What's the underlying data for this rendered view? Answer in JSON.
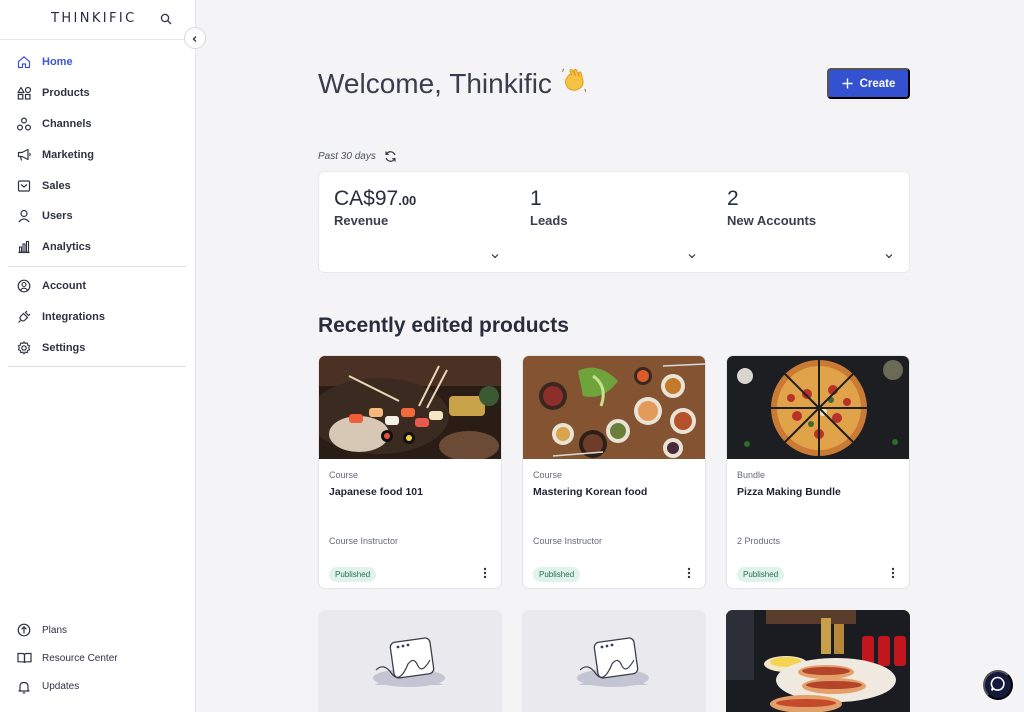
{
  "brand": {
    "name": "THINKIFIC"
  },
  "sidebar": {
    "items": [
      {
        "label": "Home",
        "icon": "home-icon",
        "active": true
      },
      {
        "label": "Products",
        "icon": "products-icon"
      },
      {
        "label": "Channels",
        "icon": "channels-icon"
      },
      {
        "label": "Marketing",
        "icon": "megaphone-icon"
      },
      {
        "label": "Sales",
        "icon": "sales-icon"
      },
      {
        "label": "Users",
        "icon": "user-icon"
      },
      {
        "label": "Analytics",
        "icon": "bar-chart-icon"
      },
      {
        "label": "Account",
        "icon": "account-icon"
      },
      {
        "label": "Integrations",
        "icon": "plug-icon"
      },
      {
        "label": "Settings",
        "icon": "gear-icon"
      }
    ],
    "bottom": [
      {
        "label": "Plans",
        "icon": "arrow-up-circle-icon"
      },
      {
        "label": "Resource Center",
        "icon": "book-icon"
      },
      {
        "label": "Updates",
        "icon": "bell-icon"
      }
    ]
  },
  "header": {
    "welcome": "Welcome, Thinkific",
    "wave": "👋",
    "create_label": "Create"
  },
  "stats": {
    "period": "Past 30 days",
    "items": [
      {
        "value_main": "CA$97",
        "value_cents": ".00",
        "label": "Revenue"
      },
      {
        "value_main": "1",
        "value_cents": "",
        "label": "Leads"
      },
      {
        "value_main": "2",
        "value_cents": "",
        "label": "New Accounts"
      }
    ]
  },
  "products": {
    "title": "Recently edited products",
    "items": [
      {
        "type": "Course",
        "title": "Japanese food 101",
        "meta": "Course Instructor",
        "status": "Published",
        "image": "sushi-image"
      },
      {
        "type": "Course",
        "title": "Mastering Korean food",
        "meta": "Course Instructor",
        "status": "Published",
        "image": "korean-food-image"
      },
      {
        "type": "Bundle",
        "title": "Pizza Making Bundle",
        "meta": "2 Products",
        "status": "Published",
        "image": "pizza-image"
      }
    ]
  },
  "colors": {
    "accent": "#3452d0",
    "active_nav": "#3b56d8",
    "badge_bg": "#dff3ea",
    "badge_text": "#2a6d4f",
    "background": "#f4f4f7"
  }
}
